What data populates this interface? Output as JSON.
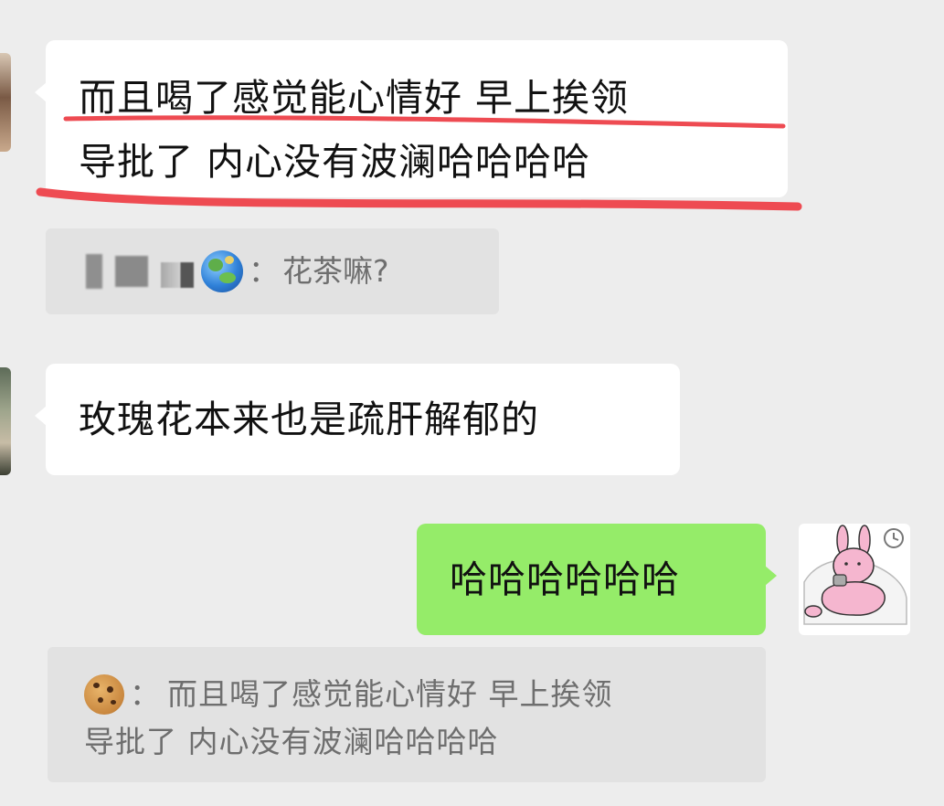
{
  "messages": [
    {
      "id": "m1",
      "text_line1": "而且喝了感觉能心情好 早上挨领",
      "text_line2": "导批了 内心没有波澜哈哈哈哈"
    },
    {
      "id": "q1",
      "quote_sender_suffix": "：",
      "quote_text": "花茶嘛?"
    },
    {
      "id": "m2",
      "text": "玫瑰花本来也是疏肝解郁的"
    },
    {
      "id": "m3",
      "text": "哈哈哈哈哈哈"
    },
    {
      "id": "q2",
      "quote_sender_suffix": "：",
      "quote_line1": "而且喝了感觉能心情好 早上挨领",
      "quote_line2": "导批了 内心没有波澜哈哈哈哈"
    }
  ],
  "icons": {
    "globe": "globe-emoji",
    "cookie": "cookie-emoji",
    "self_avatar": "rabbit-sticker-avatar"
  },
  "colors": {
    "background": "#ededed",
    "bubble_in": "#ffffff",
    "bubble_out": "#95ec69",
    "quote_bg": "#e2e2e2",
    "annotation_red": "#ee4b52"
  }
}
